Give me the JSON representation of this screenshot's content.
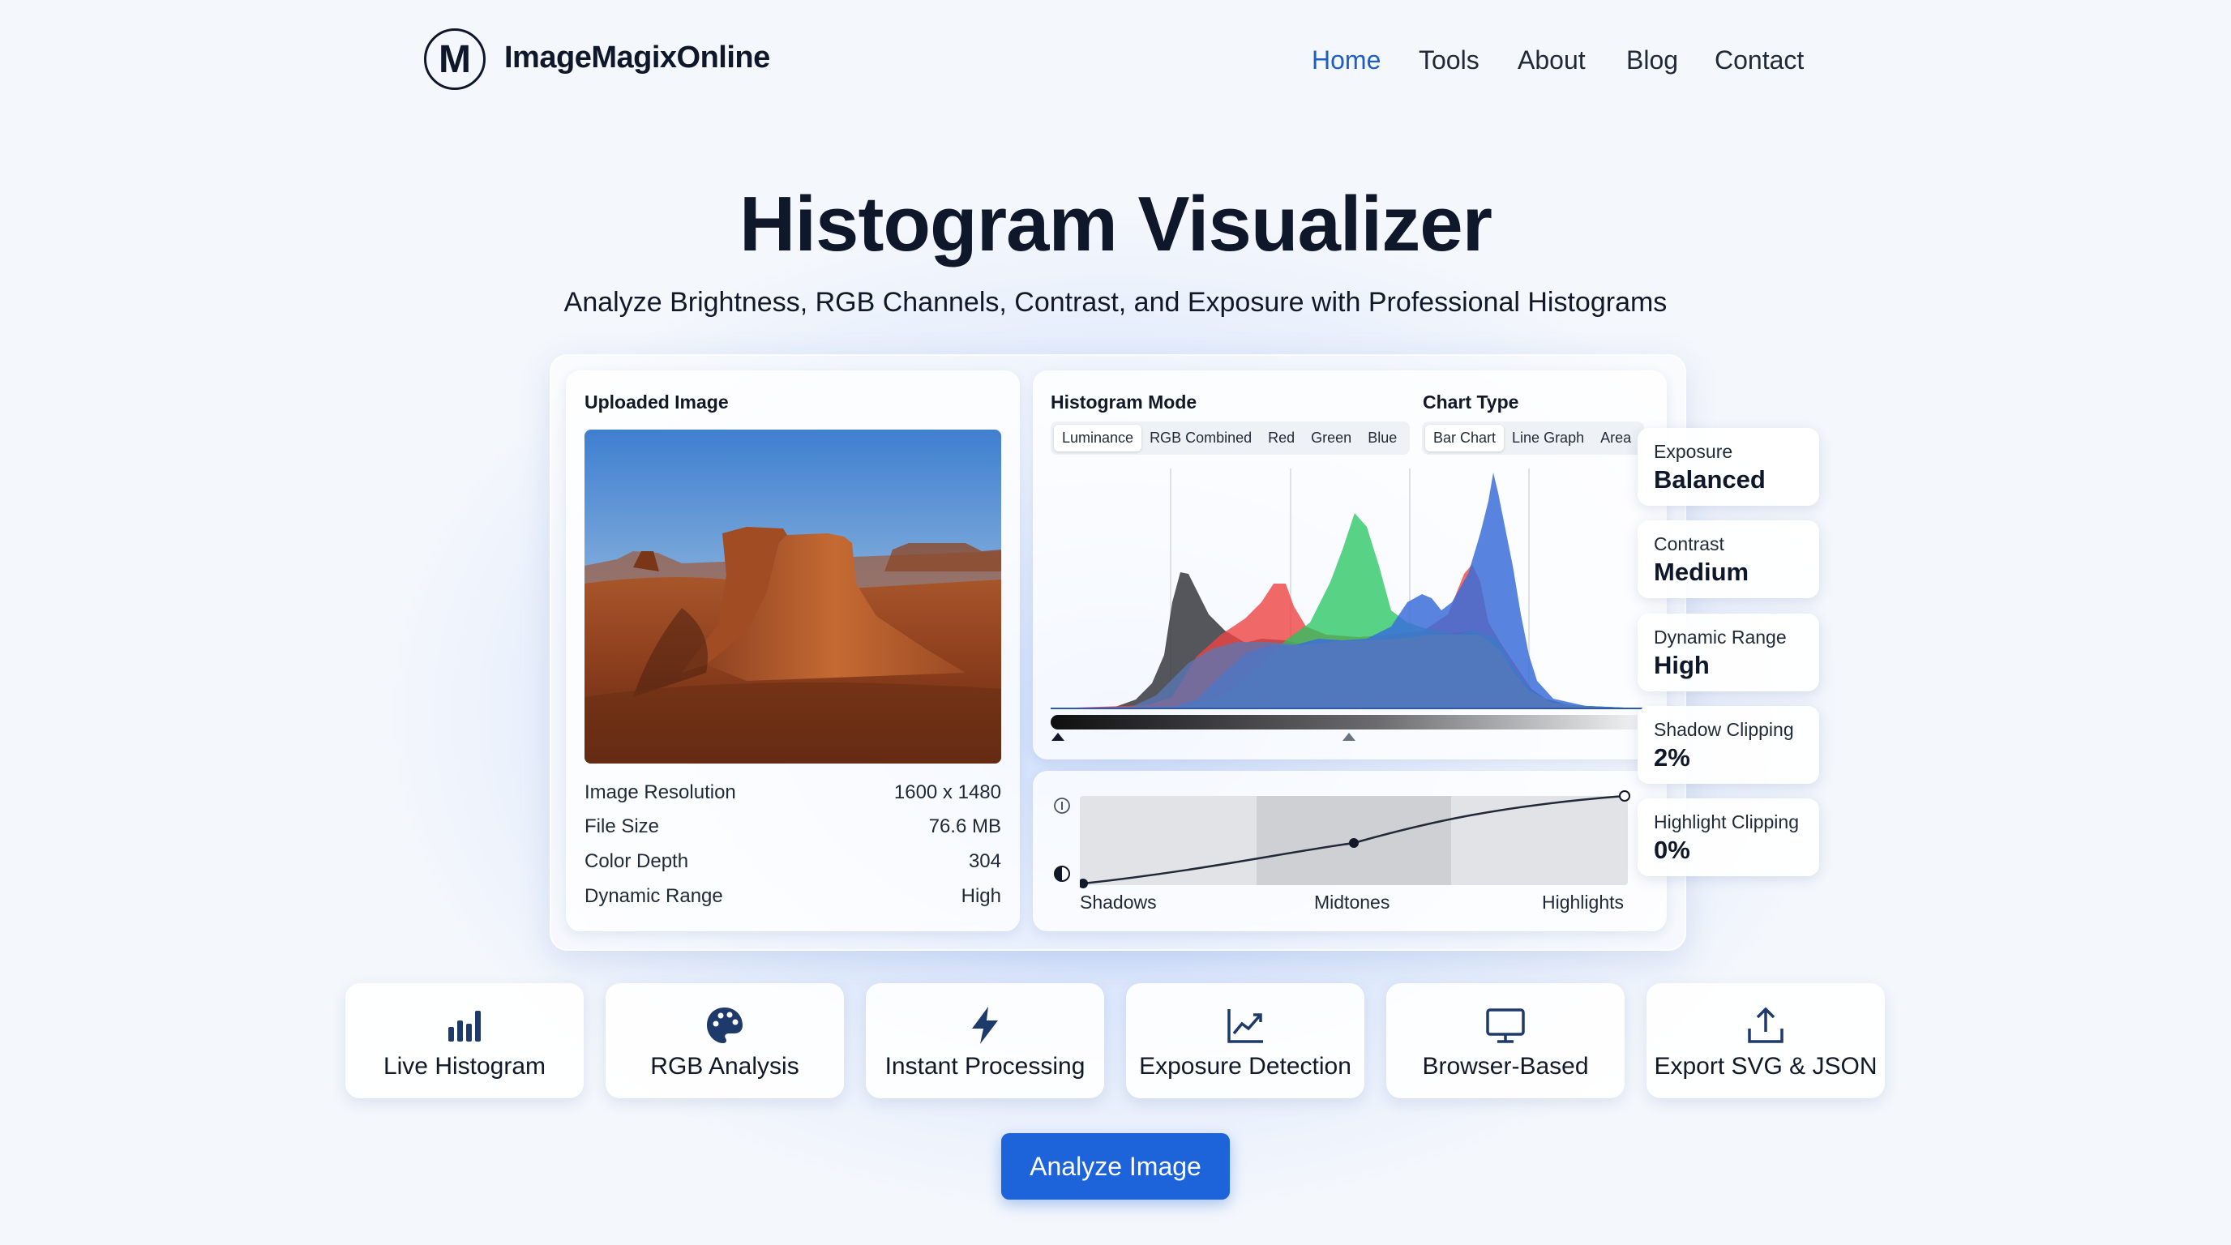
{
  "header": {
    "logo_letter": "M",
    "brand": "ImageMagixOnline",
    "nav": [
      {
        "label": "Home",
        "active": true
      },
      {
        "label": "Tools",
        "active": false
      },
      {
        "label": "About",
        "active": false
      },
      {
        "label": "Blog",
        "active": false
      },
      {
        "label": "Contact",
        "active": false
      }
    ]
  },
  "hero": {
    "title": "Histogram Visualizer",
    "subtitle": "Analyze Brightness, RGB Channels, Contrast, and Exposure with Professional Histograms"
  },
  "uploaded": {
    "heading": "Uploaded Image",
    "info": [
      {
        "label": "Image Resolution",
        "value": "1600 x 1480"
      },
      {
        "label": "File Size",
        "value": "76.6 MB"
      },
      {
        "label": "Color Depth",
        "value": "304"
      },
      {
        "label": "Dynamic Range",
        "value": "High"
      }
    ]
  },
  "histogram": {
    "mode_heading": "Histogram Mode",
    "modes": [
      "Luminance",
      "RGB Combined",
      "Red",
      "Green",
      "Blue"
    ],
    "active_mode": "Luminance",
    "chart_type_heading": "Chart Type",
    "chart_types": [
      "Bar Chart",
      "Line Graph",
      "Area"
    ],
    "active_chart_type": "Bar Chart",
    "colors": {
      "luminance": "#3f3f46",
      "red": "#ef4444",
      "green": "#22c55e",
      "blue": "#3b6fd9",
      "luminance_blend": "#5878b8"
    }
  },
  "tone_curve": {
    "labels": [
      "Shadows",
      "Midtones",
      "Highlights"
    ]
  },
  "metrics": [
    {
      "label": "Exposure",
      "value": "Balanced"
    },
    {
      "label": "Contrast",
      "value": "Medium"
    },
    {
      "label": "Dynamic Range",
      "value": "High"
    },
    {
      "label": "Shadow Clipping",
      "value": "2%"
    },
    {
      "label": "Highlight Clipping",
      "value": "0%"
    }
  ],
  "features": [
    {
      "label": "Live Histogram",
      "icon": "bar-chart-icon"
    },
    {
      "label": "RGB Analysis",
      "icon": "palette-icon"
    },
    {
      "label": "Instant Processing",
      "icon": "lightning-icon"
    },
    {
      "label": "Exposure Detection",
      "icon": "trend-chart-icon"
    },
    {
      "label": "Browser-Based",
      "icon": "monitor-icon"
    },
    {
      "label": "Export SVG & JSON",
      "icon": "upload-icon"
    }
  ],
  "cta": {
    "label": "Analyze Image"
  }
}
